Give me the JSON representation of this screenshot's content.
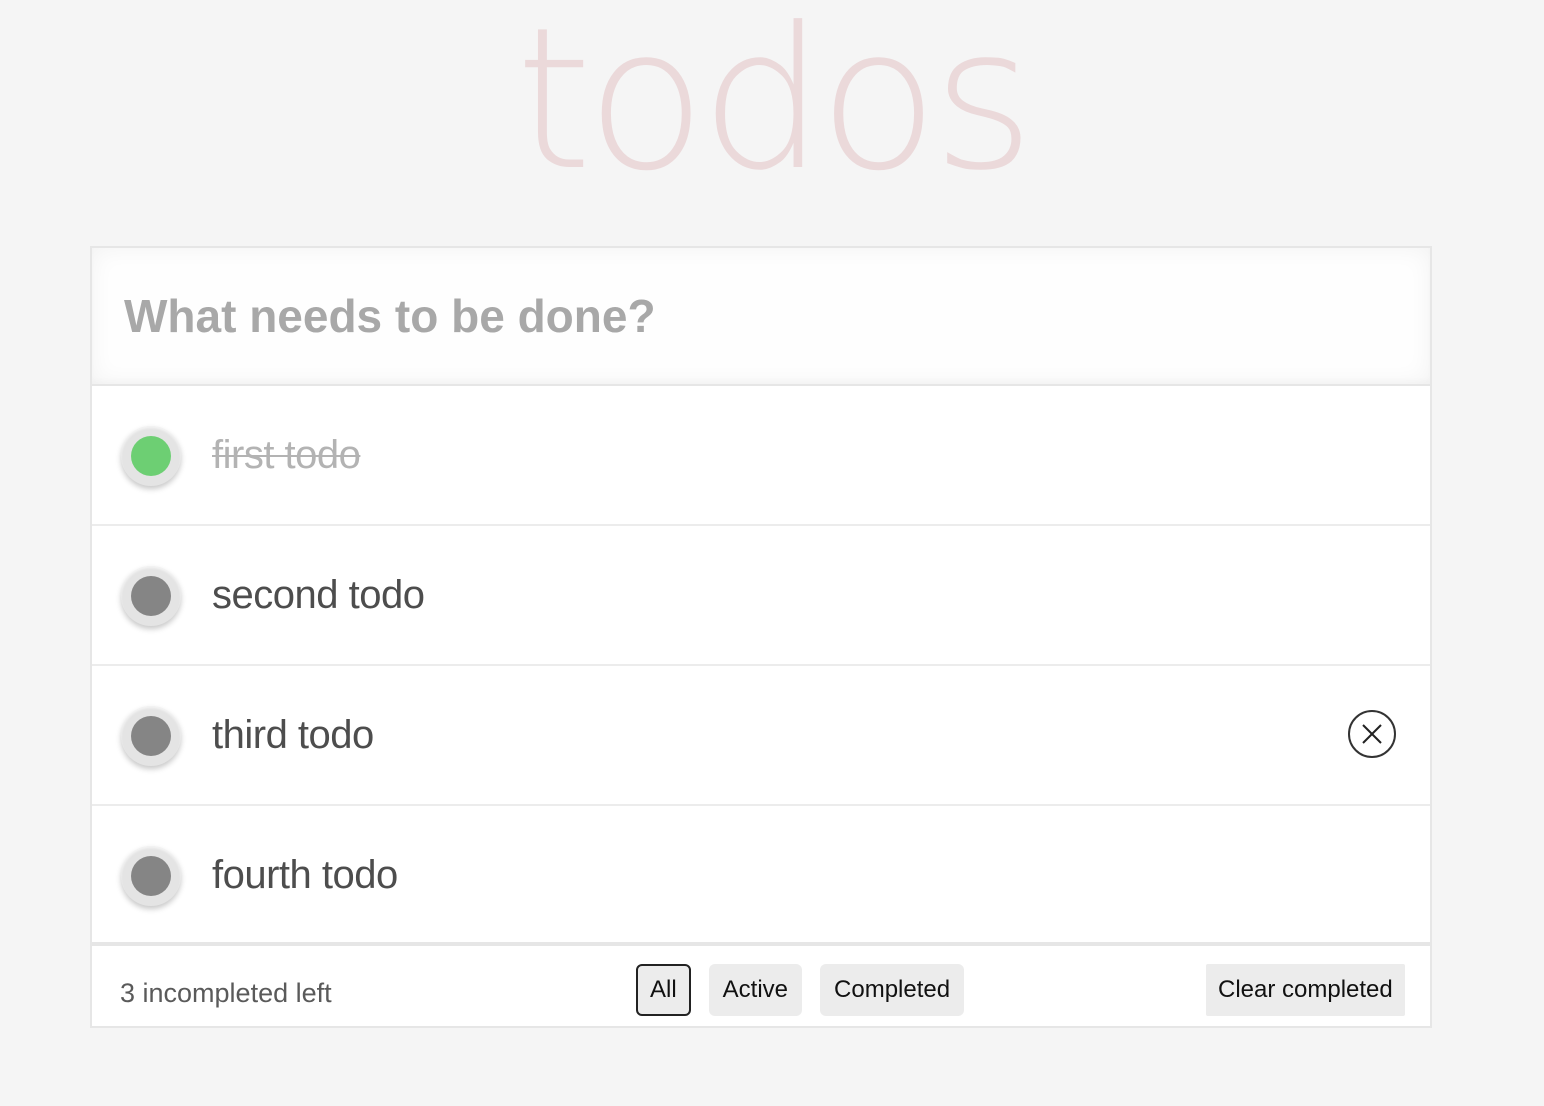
{
  "header": {
    "title": "todos"
  },
  "new_todo": {
    "placeholder": "What needs to be done?",
    "value": ""
  },
  "todos": [
    {
      "label": "first todo",
      "completed": true
    },
    {
      "label": "second todo",
      "completed": false
    },
    {
      "label": "third todo",
      "completed": false,
      "hovered": true
    },
    {
      "label": "fourth todo",
      "completed": false
    }
  ],
  "footer": {
    "count_text": "3 incompleted left",
    "filters": [
      {
        "label": "All",
        "selected": true
      },
      {
        "label": "Active",
        "selected": false
      },
      {
        "label": "Completed",
        "selected": false
      }
    ],
    "clear_completed_label": "Clear completed"
  },
  "colors": {
    "completed_toggle": "#6dcf73",
    "active_toggle": "#858585",
    "title": "#efdfdf",
    "background": "#f5f5f5"
  },
  "icons": {
    "destroy": "close-icon"
  }
}
